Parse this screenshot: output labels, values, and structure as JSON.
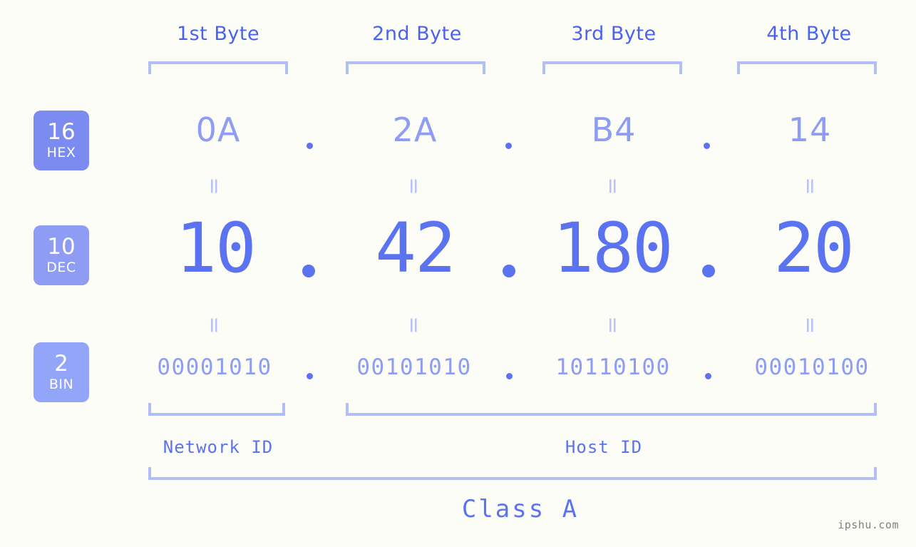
{
  "background_color": "#fbfdf6",
  "accent_strong": "#5b73f0",
  "accent_mid": "#8e9cf3",
  "accent_light": "#b3bdf9",
  "header": {
    "bytes": [
      {
        "label": "1st Byte"
      },
      {
        "label": "2nd Byte"
      },
      {
        "label": "3rd Byte"
      },
      {
        "label": "4th Byte"
      }
    ]
  },
  "bases": [
    {
      "number": "16",
      "name": "HEX",
      "color": "#7b8bef"
    },
    {
      "number": "10",
      "name": "DEC",
      "color": "#8e9cf3"
    },
    {
      "number": "2",
      "name": "BIN",
      "color": "#93a5f8"
    }
  ],
  "rows": {
    "hex": {
      "base": "16",
      "values": [
        "0A",
        "2A",
        "B4",
        "14"
      ],
      "separator": "."
    },
    "dec": {
      "base": "10",
      "values": [
        "10",
        "42",
        "180",
        "20"
      ],
      "separator": "."
    },
    "bin": {
      "base": "2",
      "values": [
        "00001010",
        "00101010",
        "10110100",
        "00010100"
      ],
      "separator": "."
    }
  },
  "equals": {
    "symbol": "="
  },
  "footer": {
    "network_id_label": "Network ID",
    "host_id_label": "Host ID",
    "class_label": "Class A"
  },
  "watermark": {
    "text": "ipshu.com"
  }
}
